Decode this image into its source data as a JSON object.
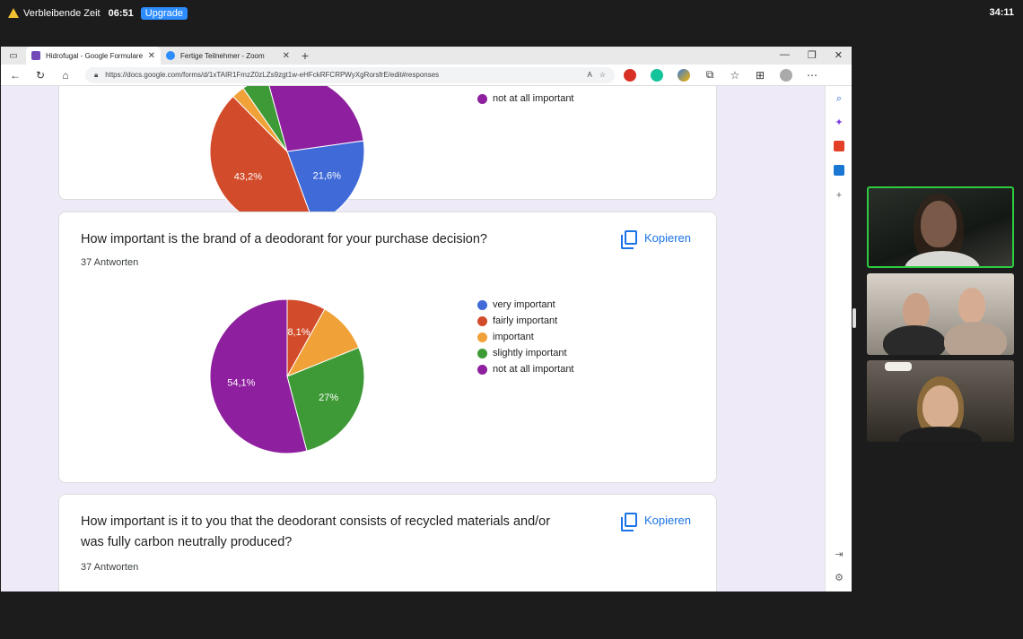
{
  "zoom": {
    "remaining_label": "Verbleibende Zeit",
    "remaining_time": "06:51",
    "upgrade_label": "Upgrade",
    "meeting_time": "34:11"
  },
  "browser": {
    "tabs": [
      {
        "label": "Hidrofugal - Google Formulare",
        "active": true,
        "icon": "google-forms-icon",
        "color": "#7248b9"
      },
      {
        "label": "Fertige Teilnehmer - Zoom",
        "active": false,
        "icon": "zoom-icon",
        "color": "#2d8cff"
      }
    ],
    "url": "https://docs.google.com/forms/d/1xTAIR1FmzZ0zLZs9zgt1w-eHFckRFCRPWyXgRorsfrE/edit#responses"
  },
  "legend_colors": {
    "very important": "#3f6ad8",
    "fairly important": "#d24b2a",
    "important": "#f0a238",
    "slightly important": "#3e9a36",
    "not at all important": "#8e1f9e"
  },
  "card1": {
    "legend_visible": "not at all important"
  },
  "card2": {
    "question": "How important is the brand of a deodorant for your purchase decision?",
    "count": "37 Antworten",
    "copy_label": "Kopieren"
  },
  "card3": {
    "question_line1": "How important is it to you that the deodorant consists of recycled materials and/or",
    "question_line2": "was fully carbon neutrally produced?",
    "count": "37 Antworten",
    "copy_label": "Kopieren"
  },
  "chart_data": [
    {
      "type": "pie",
      "title": "",
      "categories": [
        "very important",
        "fairly important",
        "important",
        "slightly important",
        "not at all important"
      ],
      "values": [
        21.6,
        43.2,
        2.7,
        5.4,
        27.0
      ],
      "labels_shown": [
        "21,6%",
        "43,2%"
      ],
      "note": "partially scrolled out of view"
    },
    {
      "type": "pie",
      "title": "How important is the brand of a deodorant for your purchase decision?",
      "categories": [
        "very important",
        "fairly important",
        "important",
        "slightly important",
        "not at all important"
      ],
      "values": [
        0,
        8.1,
        10.8,
        27.0,
        54.1
      ],
      "labels_shown": [
        "",
        "8,1%",
        "",
        "27%",
        "54,1%"
      ],
      "legend_position": "right"
    }
  ]
}
